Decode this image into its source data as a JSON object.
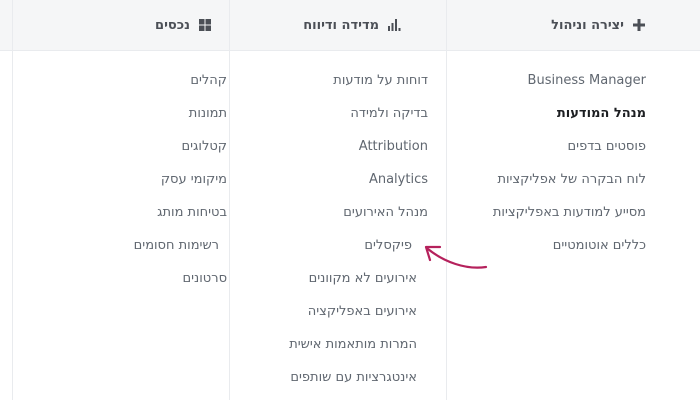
{
  "columns": {
    "create": {
      "title": "יצירה וניהול",
      "icon": "plus-icon",
      "items": [
        "Business Manager",
        "מנהל המודעות",
        "פוסטים בדפים",
        "לוח הבקרה של אפליקציות",
        "מסייע למודעות באפליקציות",
        "כללים אוטומטיים"
      ],
      "active_index": 1
    },
    "measure": {
      "title": "מדידה ודיווח",
      "icon": "bar-chart-icon",
      "items": [
        "דוחות על מודעות",
        "בדיקה ולמידה",
        "Attribution",
        "Analytics",
        "מנהל האירועים",
        "פיקסלים",
        "אירועים לא מקוונים",
        "אירועים באפליקציה",
        "המרות מותאמות אישית",
        "אינטגרציות עם שותפים"
      ]
    },
    "assets": {
      "title": "נכסים",
      "icon": "grid-icon",
      "items": [
        "קהלים",
        "תמונות",
        "קטלוגים",
        "מיקומי עסק",
        "בטיחות מותג",
        "רשימות חסומים",
        "סרטונים"
      ]
    }
  },
  "colors": {
    "header_bg": "#f5f6f7",
    "text": "#606770",
    "active_text": "#1c1e21",
    "arrow": "#b5215c"
  }
}
